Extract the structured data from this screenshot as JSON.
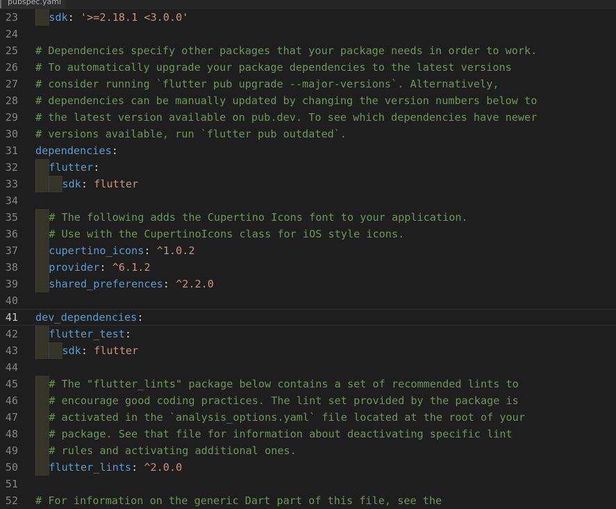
{
  "tab": {
    "filename": "pubspec.yaml"
  },
  "colors": {
    "background": "#1e1e1e",
    "comment": "#6a9955",
    "key": "#569cd6",
    "string": "#ce9178",
    "punctuation": "#d4d4d4",
    "line_number": "#858585"
  },
  "editor": {
    "current_line": 41,
    "lines": [
      {
        "n": "23",
        "i": 1,
        "tokens": [
          {
            "t": "k",
            "v": "sdk"
          },
          {
            "t": "p",
            "v": ": "
          },
          {
            "t": "s",
            "v": "'>=2.18.1 <3.0.0'"
          }
        ]
      },
      {
        "n": "24",
        "i": 0,
        "tokens": []
      },
      {
        "n": "25",
        "i": 0,
        "tokens": [
          {
            "t": "c",
            "v": "# Dependencies specify other packages that your package needs in order to work."
          }
        ]
      },
      {
        "n": "26",
        "i": 0,
        "tokens": [
          {
            "t": "c",
            "v": "# To automatically upgrade your package dependencies to the latest versions"
          }
        ]
      },
      {
        "n": "27",
        "i": 0,
        "tokens": [
          {
            "t": "c",
            "v": "# consider running `flutter pub upgrade --major-versions`. Alternatively,"
          }
        ]
      },
      {
        "n": "28",
        "i": 0,
        "tokens": [
          {
            "t": "c",
            "v": "# dependencies can be manually updated by changing the version numbers below to"
          }
        ]
      },
      {
        "n": "29",
        "i": 0,
        "tokens": [
          {
            "t": "c",
            "v": "# the latest version available on pub.dev. To see which dependencies have newer"
          }
        ]
      },
      {
        "n": "30",
        "i": 0,
        "tokens": [
          {
            "t": "c",
            "v": "# versions available, run `flutter pub outdated`."
          }
        ]
      },
      {
        "n": "31",
        "i": 0,
        "tokens": [
          {
            "t": "k",
            "v": "dependencies"
          },
          {
            "t": "p",
            "v": ":"
          }
        ]
      },
      {
        "n": "32",
        "i": 1,
        "tokens": [
          {
            "t": "k",
            "v": "flutter"
          },
          {
            "t": "p",
            "v": ":"
          }
        ]
      },
      {
        "n": "33",
        "i": 2,
        "tokens": [
          {
            "t": "k",
            "v": "sdk"
          },
          {
            "t": "p",
            "v": ": "
          },
          {
            "t": "s",
            "v": "flutter"
          }
        ]
      },
      {
        "n": "34",
        "i": 0,
        "tokens": []
      },
      {
        "n": "35",
        "i": 1,
        "tokens": [
          {
            "t": "c",
            "v": "# The following adds the Cupertino Icons font to your application."
          }
        ]
      },
      {
        "n": "36",
        "i": 1,
        "tokens": [
          {
            "t": "c",
            "v": "# Use with the CupertinoIcons class for iOS style icons."
          }
        ]
      },
      {
        "n": "37",
        "i": 1,
        "tokens": [
          {
            "t": "k",
            "v": "cupertino_icons"
          },
          {
            "t": "p",
            "v": ": "
          },
          {
            "t": "s",
            "v": "^1.0.2"
          }
        ]
      },
      {
        "n": "38",
        "i": 1,
        "tokens": [
          {
            "t": "k",
            "v": "provider"
          },
          {
            "t": "p",
            "v": ": "
          },
          {
            "t": "s",
            "v": "^6.1.2"
          }
        ]
      },
      {
        "n": "39",
        "i": 1,
        "tokens": [
          {
            "t": "k",
            "v": "shared_preferences"
          },
          {
            "t": "p",
            "v": ": "
          },
          {
            "t": "s",
            "v": "^2.2.0"
          }
        ]
      },
      {
        "n": "40",
        "i": 0,
        "tokens": []
      },
      {
        "n": "41",
        "i": 0,
        "tokens": [
          {
            "t": "k",
            "v": "dev_dependencies"
          },
          {
            "t": "p",
            "v": ":"
          }
        ]
      },
      {
        "n": "42",
        "i": 1,
        "tokens": [
          {
            "t": "k",
            "v": "flutter_test"
          },
          {
            "t": "p",
            "v": ":"
          }
        ]
      },
      {
        "n": "43",
        "i": 2,
        "tokens": [
          {
            "t": "k",
            "v": "sdk"
          },
          {
            "t": "p",
            "v": ": "
          },
          {
            "t": "s",
            "v": "flutter"
          }
        ]
      },
      {
        "n": "44",
        "i": 0,
        "tokens": []
      },
      {
        "n": "45",
        "i": 1,
        "tokens": [
          {
            "t": "c",
            "v": "# The \"flutter_lints\" package below contains a set of recommended lints to"
          }
        ]
      },
      {
        "n": "46",
        "i": 1,
        "tokens": [
          {
            "t": "c",
            "v": "# encourage good coding practices. The lint set provided by the package is"
          }
        ]
      },
      {
        "n": "47",
        "i": 1,
        "tokens": [
          {
            "t": "c",
            "v": "# activated in the `analysis_options.yaml` file located at the root of your"
          }
        ]
      },
      {
        "n": "48",
        "i": 1,
        "tokens": [
          {
            "t": "c",
            "v": "# package. See that file for information about deactivating specific lint"
          }
        ]
      },
      {
        "n": "49",
        "i": 1,
        "tokens": [
          {
            "t": "c",
            "v": "# rules and activating additional ones."
          }
        ]
      },
      {
        "n": "50",
        "i": 1,
        "tokens": [
          {
            "t": "k",
            "v": "flutter_lints"
          },
          {
            "t": "p",
            "v": ": "
          },
          {
            "t": "s",
            "v": "^2.0.0"
          }
        ]
      },
      {
        "n": "51",
        "i": 0,
        "tokens": []
      },
      {
        "n": "52",
        "i": 0,
        "tokens": [
          {
            "t": "c",
            "v": "# For information on the generic Dart part of this file, see the"
          }
        ]
      }
    ]
  }
}
